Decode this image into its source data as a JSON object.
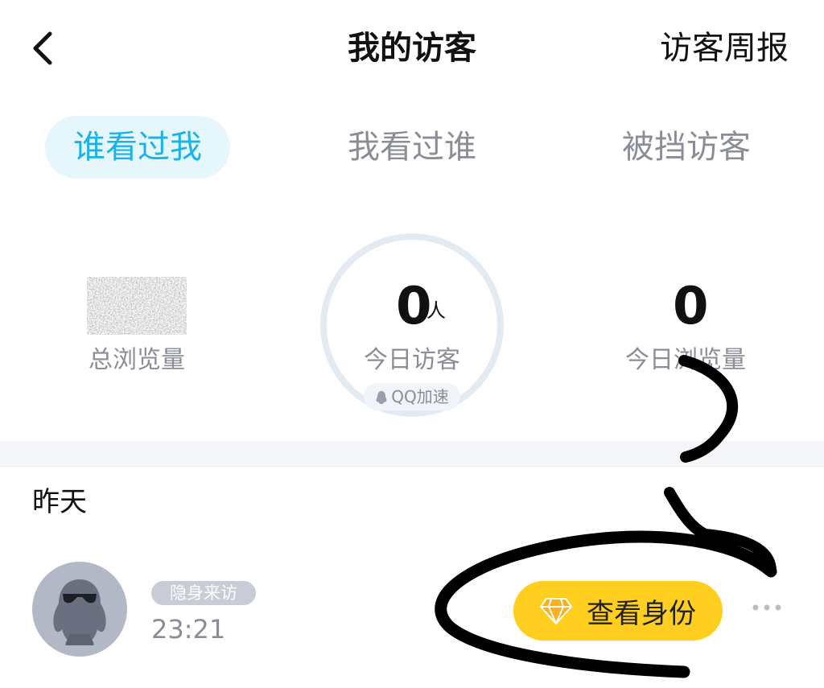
{
  "header": {
    "title": "我的访客",
    "weekly_report": "访客周报",
    "back_icon": "chevron-left-icon"
  },
  "tabs": [
    {
      "label": "谁看过我",
      "active": true
    },
    {
      "label": "我看过谁",
      "active": false
    },
    {
      "label": "被挡访客",
      "active": false
    }
  ],
  "stats": {
    "total_views_label": "总浏览量",
    "today_visitors_value": "0",
    "today_visitors_unit": "人",
    "today_visitors_label": "今日访客",
    "qq_badge": "QQ加速",
    "today_views_value": "0",
    "today_views_label": "今日浏览量"
  },
  "section": {
    "title": "昨天"
  },
  "visitors": [
    {
      "badge": "隐身来访",
      "time": "23:21",
      "button": "查看身份",
      "avatar_icon": "penguin-sunglasses-icon",
      "more_icon": "more-dots-icon"
    }
  ],
  "colors": {
    "accent": "#19b3e8",
    "tab_active_bg": "#e6f7fc",
    "button_yellow": "#ffce1f",
    "muted_text": "#8a8d98"
  }
}
